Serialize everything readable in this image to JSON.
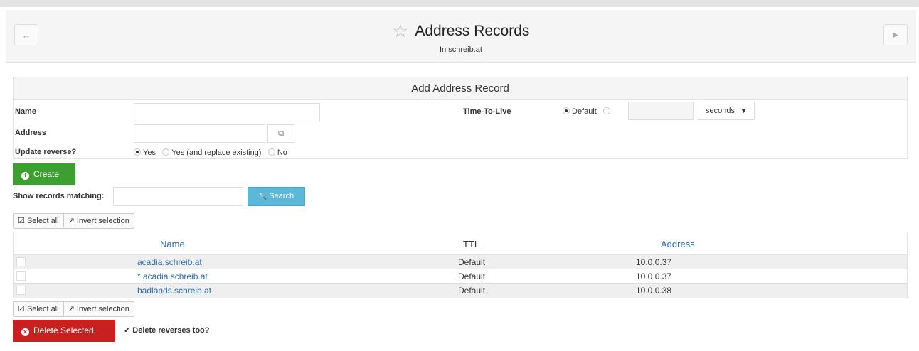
{
  "header": {
    "title": "Address Records",
    "subtitle": "In schreib.at",
    "back_icon": "←",
    "forward_icon": "▶",
    "star_icon": "☆"
  },
  "form": {
    "heading": "Add Address Record",
    "name_label": "Name",
    "name_value": "",
    "address_label": "Address",
    "address_value": "",
    "copy_icon": "⧉",
    "update_reverse_label": "Update reverse?",
    "update_reverse_options": [
      "Yes",
      "Yes (and replace existing)",
      "No"
    ],
    "update_reverse_selected": "Yes",
    "ttl_label": "Time-To-Live",
    "ttl_default_label": "Default",
    "ttl_value": "",
    "ttl_unit": "seconds",
    "ttl_unit_caret": "▼",
    "create_label": "Create",
    "create_icon": "+"
  },
  "search": {
    "label": "Show records matching:",
    "value": "",
    "button_label": "Search",
    "button_icon": "🔍"
  },
  "selection": {
    "select_all": "Select all",
    "select_all_icon": "☑",
    "invert": "Invert selection",
    "invert_icon": "↗"
  },
  "table": {
    "columns": [
      "Name",
      "TTL",
      "Address"
    ],
    "rows": [
      {
        "name": "acadia.schreib.at",
        "ttl": "Default",
        "address": "10.0.0.37"
      },
      {
        "name": "*.acadia.schreib.at",
        "ttl": "Default",
        "address": "10.0.0.37"
      },
      {
        "name": "badlands.schreib.at",
        "ttl": "Default",
        "address": "10.0.0.38"
      }
    ]
  },
  "delete": {
    "button_label": "Delete Selected",
    "button_icon": "×",
    "reverse_label": "Delete reverses too?",
    "reverse_check": "✔"
  },
  "colors": {
    "create_green": "#3d9f30",
    "search_blue": "#5bb8d9",
    "delete_red": "#c8201f",
    "link_blue": "#2a6cab"
  }
}
